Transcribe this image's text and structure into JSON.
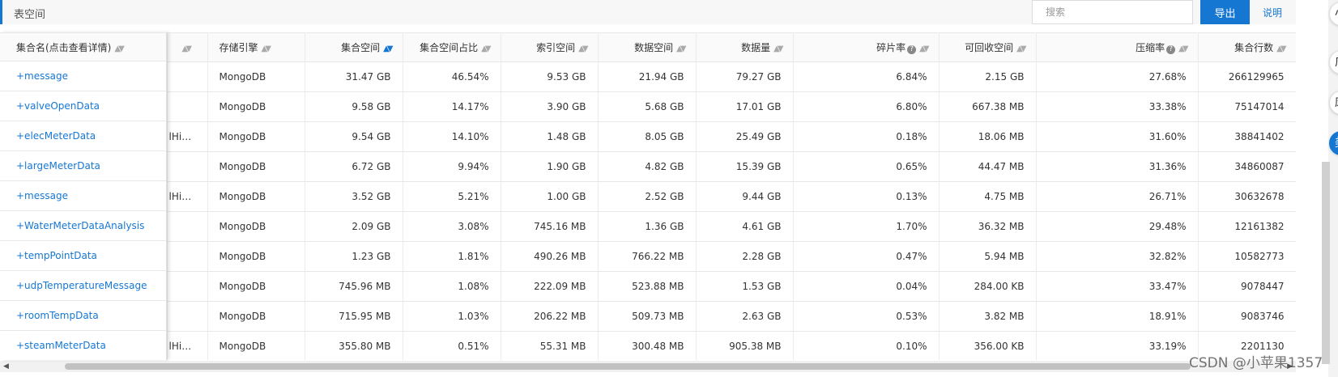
{
  "topbar": {
    "title": "表空间",
    "search_placeholder": "搜索",
    "export_label": "导出",
    "help_label": "说明"
  },
  "columns": {
    "name": "集合名(点击查看详情)",
    "engine": "存储引擎",
    "space": "集合空间",
    "space_ratio": "集合空间占比",
    "index_space": "索引空间",
    "data_space": "数据空间",
    "data_size": "数据量",
    "frag_rate": "碎片率",
    "reclaim": "可回收空间",
    "compress": "压缩率",
    "rows": "集合行数"
  },
  "rows": [
    {
      "name": "+message",
      "hidden": "",
      "engine": "MongoDB",
      "space": "31.47 GB",
      "space_ratio": "46.54%",
      "index_space": "9.53 GB",
      "data_space": "21.94 GB",
      "data_size": "79.27 GB",
      "frag_rate": "6.84%",
      "reclaim": "2.15 GB",
      "compress": "27.68%",
      "rows": "266129965"
    },
    {
      "name": "+valveOpenData",
      "hidden": "",
      "engine": "MongoDB",
      "space": "9.58 GB",
      "space_ratio": "14.17%",
      "index_space": "3.90 GB",
      "data_space": "5.68 GB",
      "data_size": "17.01 GB",
      "frag_rate": "6.80%",
      "reclaim": "667.38 MB",
      "compress": "33.38%",
      "rows": "75147014"
    },
    {
      "name": "+elecMeterData",
      "hidden": "lHis...",
      "engine": "MongoDB",
      "space": "9.54 GB",
      "space_ratio": "14.10%",
      "index_space": "1.48 GB",
      "data_space": "8.05 GB",
      "data_size": "25.49 GB",
      "frag_rate": "0.18%",
      "reclaim": "18.06 MB",
      "compress": "31.60%",
      "rows": "38841402"
    },
    {
      "name": "+largeMeterData",
      "hidden": "",
      "engine": "MongoDB",
      "space": "6.72 GB",
      "space_ratio": "9.94%",
      "index_space": "1.90 GB",
      "data_space": "4.82 GB",
      "data_size": "15.39 GB",
      "frag_rate": "0.65%",
      "reclaim": "44.47 MB",
      "compress": "31.36%",
      "rows": "34860087"
    },
    {
      "name": "+message",
      "hidden": "lHis...",
      "engine": "MongoDB",
      "space": "3.52 GB",
      "space_ratio": "5.21%",
      "index_space": "1.00 GB",
      "data_space": "2.52 GB",
      "data_size": "9.44 GB",
      "frag_rate": "0.13%",
      "reclaim": "4.75 MB",
      "compress": "26.71%",
      "rows": "30632678"
    },
    {
      "name": "+WaterMeterDataAnalysis",
      "hidden": "",
      "engine": "MongoDB",
      "space": "2.09 GB",
      "space_ratio": "3.08%",
      "index_space": "745.16 MB",
      "data_space": "1.36 GB",
      "data_size": "4.61 GB",
      "frag_rate": "1.70%",
      "reclaim": "36.32 MB",
      "compress": "29.48%",
      "rows": "12161382"
    },
    {
      "name": "+tempPointData",
      "hidden": "",
      "engine": "MongoDB",
      "space": "1.23 GB",
      "space_ratio": "1.81%",
      "index_space": "490.26 MB",
      "data_space": "766.22 MB",
      "data_size": "2.28 GB",
      "frag_rate": "0.47%",
      "reclaim": "5.94 MB",
      "compress": "32.82%",
      "rows": "10582773"
    },
    {
      "name": "+udpTemperatureMessage",
      "hidden": "",
      "engine": "MongoDB",
      "space": "745.96 MB",
      "space_ratio": "1.08%",
      "index_space": "222.09 MB",
      "data_space": "523.88 MB",
      "data_size": "1.53 GB",
      "frag_rate": "0.04%",
      "reclaim": "284.00 KB",
      "compress": "33.47%",
      "rows": "9078447"
    },
    {
      "name": "+roomTempData",
      "hidden": "",
      "engine": "MongoDB",
      "space": "715.95 MB",
      "space_ratio": "1.03%",
      "index_space": "206.22 MB",
      "data_space": "509.73 MB",
      "data_size": "2.63 GB",
      "frag_rate": "0.53%",
      "reclaim": "3.82 MB",
      "compress": "18.91%",
      "rows": "9083746"
    },
    {
      "name": "+steamMeterData",
      "hidden": "lHis...",
      "engine": "MongoDB",
      "space": "355.80 MB",
      "space_ratio": "0.51%",
      "index_space": "55.31 MB",
      "data_space": "300.48 MB",
      "data_size": "905.38 MB",
      "frag_rate": "0.10%",
      "reclaim": "356.00 KB",
      "compress": "33.19%",
      "rows": "2201130"
    }
  ],
  "side_buttons": [
    "小",
    "广",
    "废",
    "美"
  ],
  "watermark": "CSDN @小苹果1357",
  "colors": {
    "accent": "#1677d2",
    "header_bg": "#fafafa"
  }
}
